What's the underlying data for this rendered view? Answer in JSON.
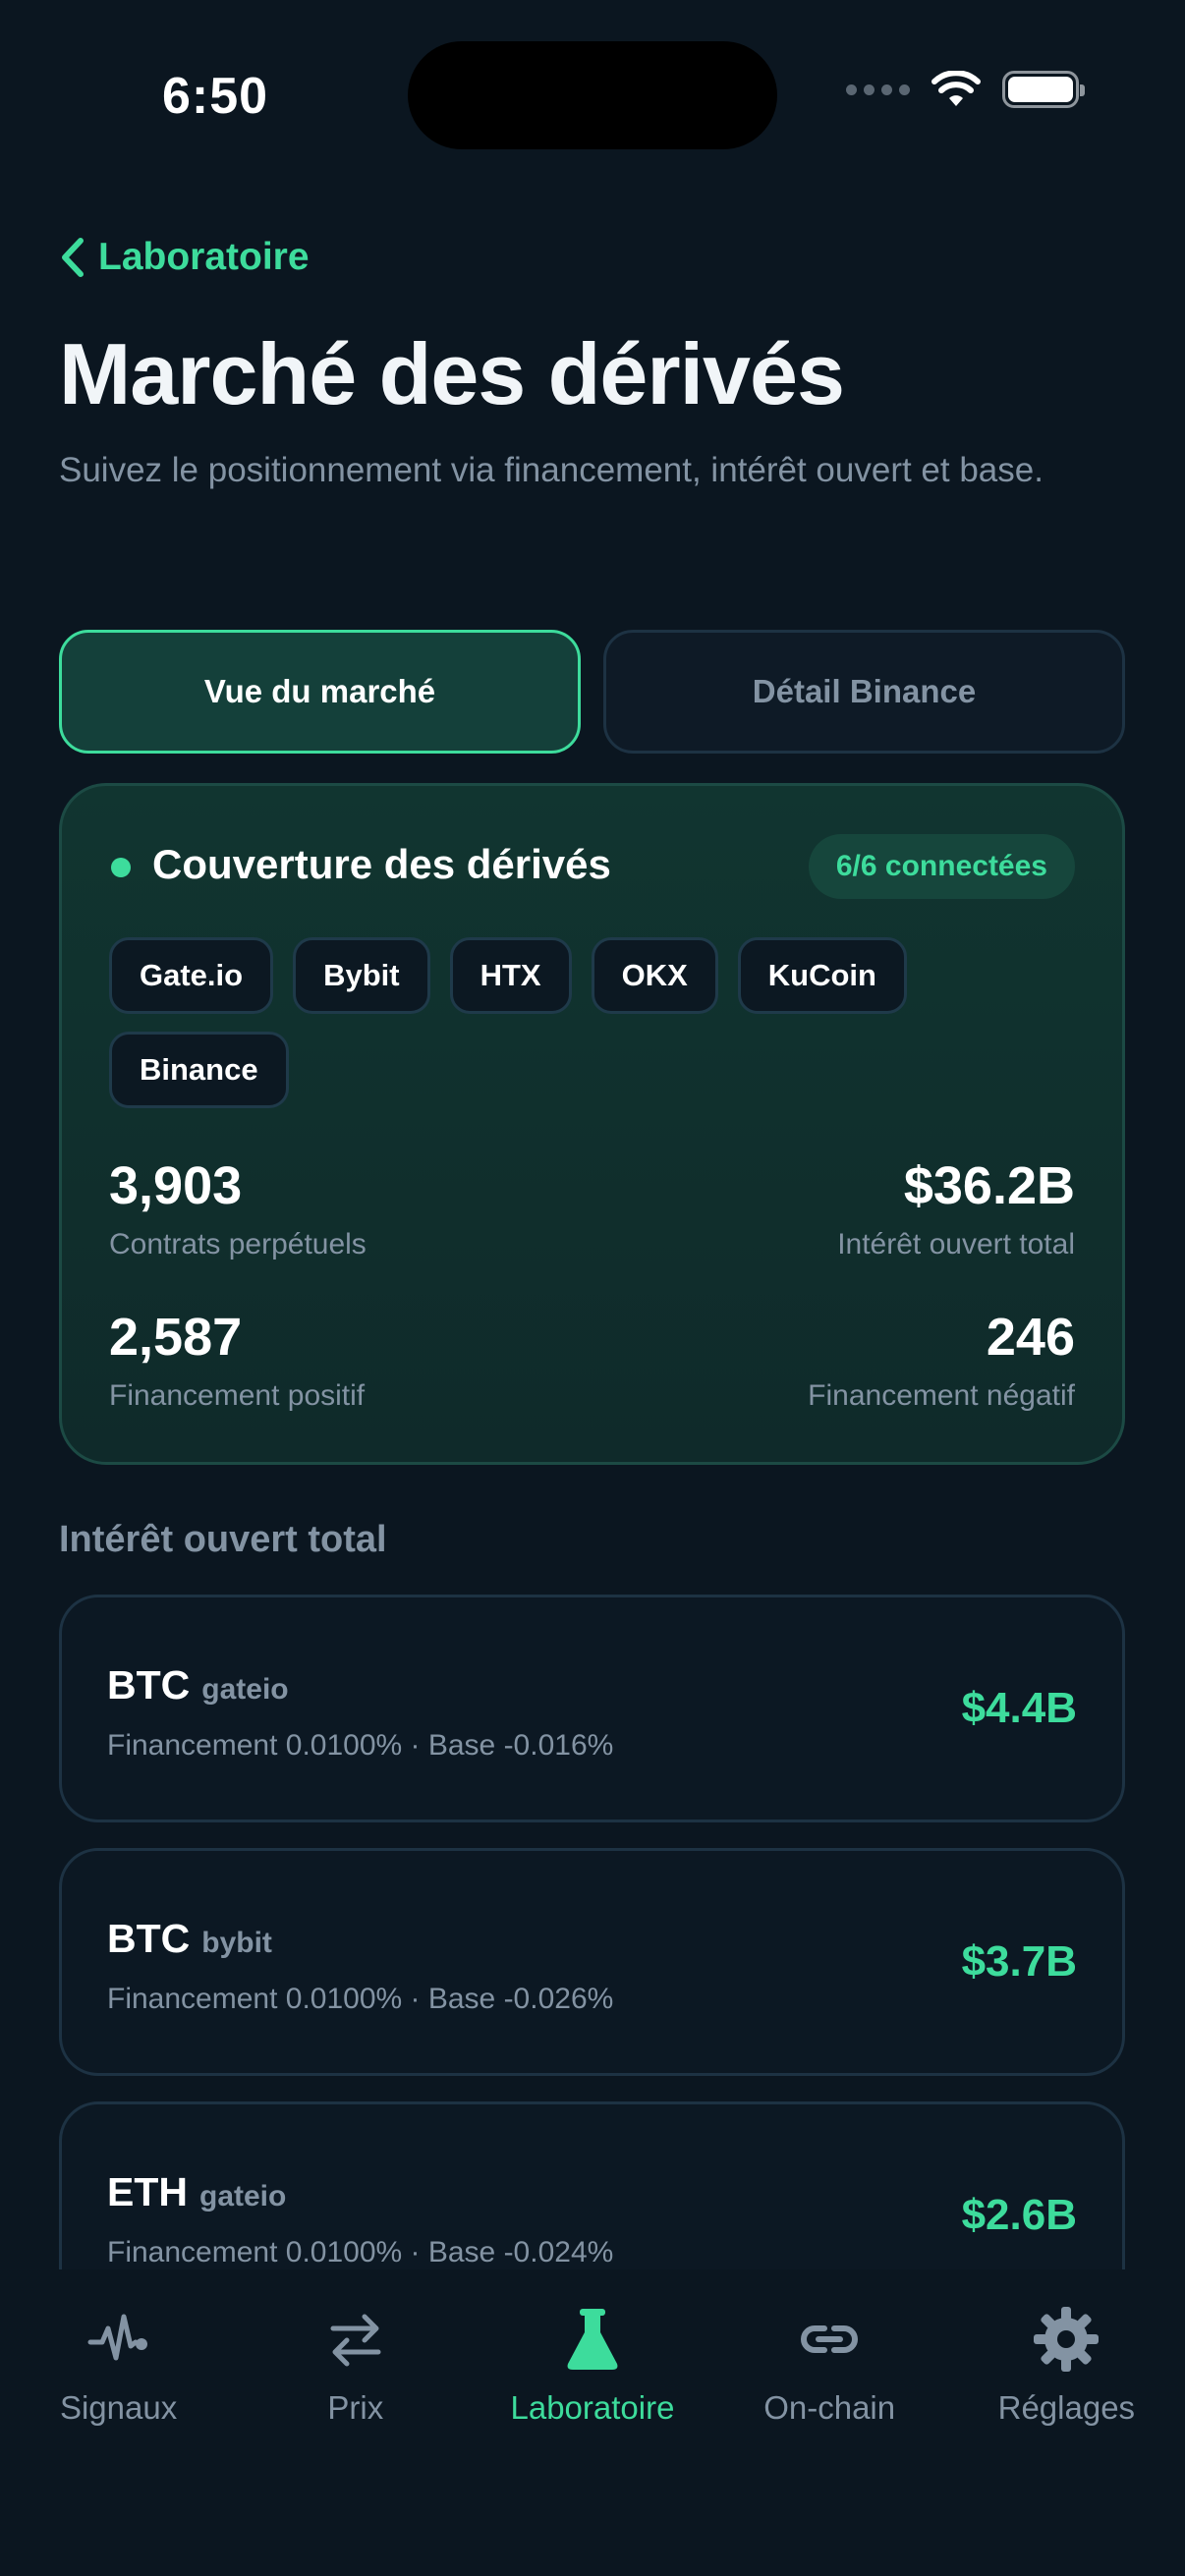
{
  "status_bar": {
    "time": "6:50"
  },
  "nav": {
    "back_label": "Laboratoire"
  },
  "header": {
    "title": "Marché des dérivés",
    "subtitle": "Suivez le positionnement via financement, intérêt ouvert et base."
  },
  "tabs": [
    {
      "label": "Vue du marché",
      "active": true
    },
    {
      "label": "Détail Binance",
      "active": false
    }
  ],
  "coverage": {
    "title": "Couverture des dérivés",
    "badge": "6/6 connectées",
    "exchanges": [
      "Gate.io",
      "Bybit",
      "HTX",
      "OKX",
      "KuCoin",
      "Binance"
    ],
    "stats": {
      "perpetuals": {
        "value": "3,903",
        "label": "Contrats perpétuels"
      },
      "total_oi": {
        "value": "$36.2B",
        "label": "Intérêt ouvert total"
      },
      "positive_funding": {
        "value": "2,587",
        "label": "Financement positif"
      },
      "negative_funding": {
        "value": "246",
        "label": "Financement négatif"
      }
    }
  },
  "section": {
    "title": "Intérêt ouvert total"
  },
  "open_interest": [
    {
      "symbol": "BTC",
      "exchange": "gateio",
      "meta": "Financement 0.0100% · Base -0.016%",
      "value": "$4.4B"
    },
    {
      "symbol": "BTC",
      "exchange": "bybit",
      "meta": "Financement 0.0100% · Base -0.026%",
      "value": "$3.7B"
    },
    {
      "symbol": "ETH",
      "exchange": "gateio",
      "meta": "Financement 0.0100% · Base -0.024%",
      "value": "$2.6B"
    }
  ],
  "tab_bar": [
    {
      "label": "Signaux",
      "icon": "pulse-icon",
      "active": false
    },
    {
      "label": "Prix",
      "icon": "swap-arrows-icon",
      "active": false
    },
    {
      "label": "Laboratoire",
      "icon": "flask-icon",
      "active": true
    },
    {
      "label": "On-chain",
      "icon": "link-icon",
      "active": false
    },
    {
      "label": "Réglages",
      "icon": "gear-icon",
      "active": false
    }
  ],
  "colors": {
    "accent": "#3ddc9c",
    "background": "#0b1620",
    "muted": "#8393a3"
  }
}
